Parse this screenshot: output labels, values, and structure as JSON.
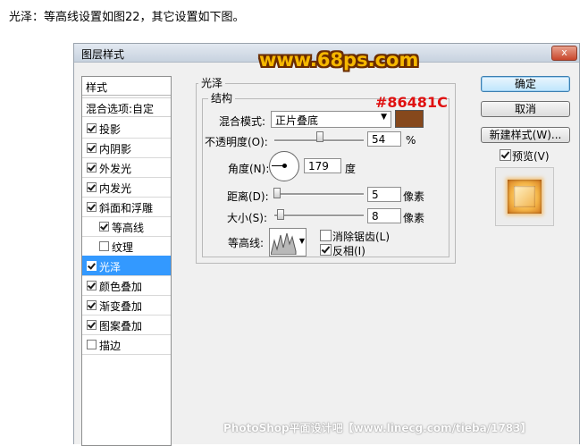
{
  "caption": "光泽：等高线设置如图22，其它设置如下图。",
  "dialog": {
    "title": "图层样式",
    "close_symbol": "x",
    "style_list": {
      "header": "样式",
      "blend_options": "混合选项:自定",
      "items": [
        {
          "label": "投影",
          "checked": true,
          "sub": false,
          "selected": false
        },
        {
          "label": "内阴影",
          "checked": true,
          "sub": false,
          "selected": false
        },
        {
          "label": "外发光",
          "checked": true,
          "sub": false,
          "selected": false
        },
        {
          "label": "内发光",
          "checked": true,
          "sub": false,
          "selected": false
        },
        {
          "label": "斜面和浮雕",
          "checked": true,
          "sub": false,
          "selected": false
        },
        {
          "label": "等高线",
          "checked": true,
          "sub": true,
          "selected": false
        },
        {
          "label": "纹理",
          "checked": false,
          "sub": true,
          "selected": false
        },
        {
          "label": "光泽",
          "checked": true,
          "sub": false,
          "selected": true
        },
        {
          "label": "颜色叠加",
          "checked": true,
          "sub": false,
          "selected": false
        },
        {
          "label": "渐变叠加",
          "checked": true,
          "sub": false,
          "selected": false
        },
        {
          "label": "图案叠加",
          "checked": true,
          "sub": false,
          "selected": false
        },
        {
          "label": "描边",
          "checked": false,
          "sub": false,
          "selected": false
        }
      ]
    },
    "satin": {
      "group_title": "光泽",
      "structure_title": "结构",
      "blend_mode_label": "混合模式:",
      "blend_mode_value": "正片叠底",
      "color_hex_label": "#86481C",
      "color": "#86481c",
      "opacity_label": "不透明度(O):",
      "opacity_value": "54",
      "opacity_unit": "%",
      "angle_label": "角度(N):",
      "angle_value": "179",
      "angle_unit": "度",
      "distance_label": "距离(D):",
      "distance_value": "5",
      "distance_unit": "像素",
      "size_label": "大小(S):",
      "size_value": "8",
      "size_unit": "像素",
      "contour_label": "等高线:",
      "antialias_label": "消除锯齿(L)",
      "antialias_checked": false,
      "invert_label": "反相(I)",
      "invert_checked": true
    },
    "buttons": {
      "ok": "确定",
      "cancel": "取消",
      "new_style": "新建样式(W)...",
      "preview_label": "预览(V)",
      "preview_checked": true
    }
  },
  "watermark_top": "www.68ps.com",
  "watermark_bottom": "PhotoShop平面设计吧【www.linecg.com/tieba/1783】"
}
